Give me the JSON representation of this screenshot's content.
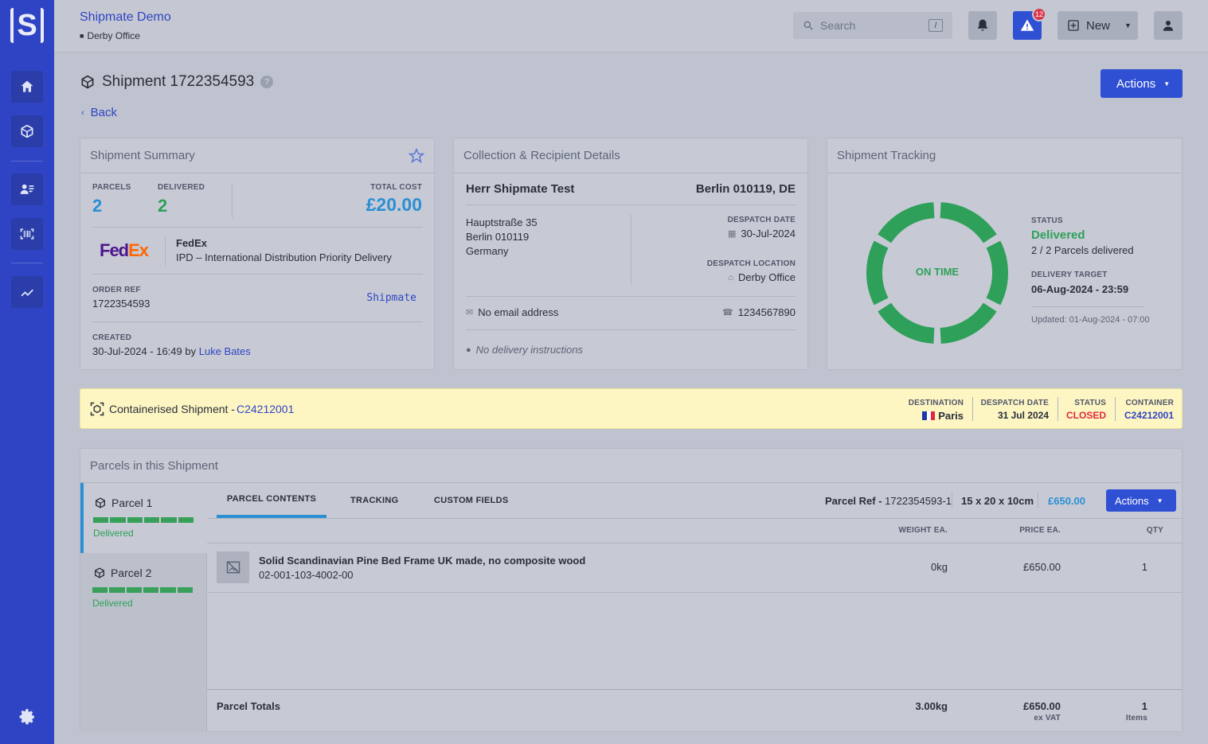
{
  "app": {
    "title": "Shipmate Demo",
    "office": "Derby Office",
    "logo_letter": "S"
  },
  "topbar": {
    "search_placeholder": "Search",
    "search_shortcut": "/",
    "alerts_count": "12",
    "new_label": "New"
  },
  "page": {
    "title": "Shipment 1722354593",
    "help": "?",
    "back_label": "Back",
    "actions_label": "Actions"
  },
  "summary": {
    "title": "Shipment Summary",
    "parcels_label": "PARCELS",
    "parcels_value": "2",
    "delivered_label": "DELIVERED",
    "delivered_value": "2",
    "total_cost_label": "TOTAL COST",
    "total_cost_value": "£20.00",
    "carrier_logo": "FedEx",
    "carrier_name": "FedEx",
    "carrier_service": "IPD – International Distribution Priority Delivery",
    "order_ref_label": "ORDER REF",
    "order_ref_value": "1722354593",
    "brand": "Shipmate",
    "created_label": "CREATED",
    "created_value": "30-Jul-2024 - 16:49",
    "created_by_prefix": "by",
    "created_by": "Luke Bates"
  },
  "recipient": {
    "title": "Collection & Recipient Details",
    "name": "Herr Shipmate Test",
    "city_line": "Berlin 010119, DE",
    "address_lines": [
      "Hauptstraße 35",
      "Berlin 010119",
      "Germany"
    ],
    "despatch_date_label": "DESPATCH DATE",
    "despatch_date_value": "30-Jul-2024",
    "despatch_location_label": "DESPATCH LOCATION",
    "despatch_location_value": "Derby Office",
    "email": "No email address",
    "phone": "1234567890",
    "instructions": "No delivery instructions"
  },
  "tracking": {
    "title": "Shipment Tracking",
    "ring_label": "ON TIME",
    "status_label": "STATUS",
    "status_value": "Delivered",
    "parcels_delivered": "2 / 2 Parcels delivered",
    "target_label": "DELIVERY TARGET",
    "target_value": "06-Aug-2024 - 23:59",
    "updated": "Updated: 01-Aug-2024 - 07:00",
    "segments_complete": 6,
    "segments_total": 6
  },
  "container": {
    "prefix": "Containerised Shipment - ",
    "id": "C24212001",
    "destination_label": "DESTINATION",
    "destination_value": "Paris",
    "despatch_label": "DESPATCH DATE",
    "despatch_value": "31 Jul 2024",
    "status_label": "STATUS",
    "status_value": "CLOSED",
    "container_label": "CONTAINER",
    "container_value": "C24212001"
  },
  "parcels": {
    "title": "Parcels in this Shipment",
    "items": [
      {
        "label": "Parcel 1",
        "status": "Delivered",
        "progress": 1.0
      },
      {
        "label": "Parcel 2",
        "status": "Delivered",
        "progress": 1.0
      }
    ],
    "tabs": [
      "PARCEL CONTENTS",
      "TRACKING",
      "CUSTOM FIELDS"
    ],
    "parcel_ref_label": "Parcel Ref - ",
    "parcel_ref_value": "1722354593-1",
    "dimensions": "15 x 20 x 10cm",
    "value": "£650.00",
    "actions_label": "Actions",
    "columns": [
      "WEIGHT EA.",
      "PRICE EA.",
      "QTY"
    ],
    "rows": [
      {
        "name": "Solid Scandinavian Pine Bed Frame UK made, no composite wood",
        "sku": "02-001-103-4002-00",
        "weight": "0kg",
        "price": "£650.00",
        "qty": "1"
      }
    ],
    "totals_label": "Parcel Totals",
    "total_weight": "3.00kg",
    "total_price": "£650.00",
    "total_price_sub": "ex VAT",
    "total_qty": "1",
    "total_qty_sub": "Items"
  },
  "colors": {
    "sidebar": "#2f44c4",
    "accent": "#3050d4",
    "success": "#2ea05a",
    "danger": "#e0283e",
    "banner": "#fdf6c3"
  }
}
